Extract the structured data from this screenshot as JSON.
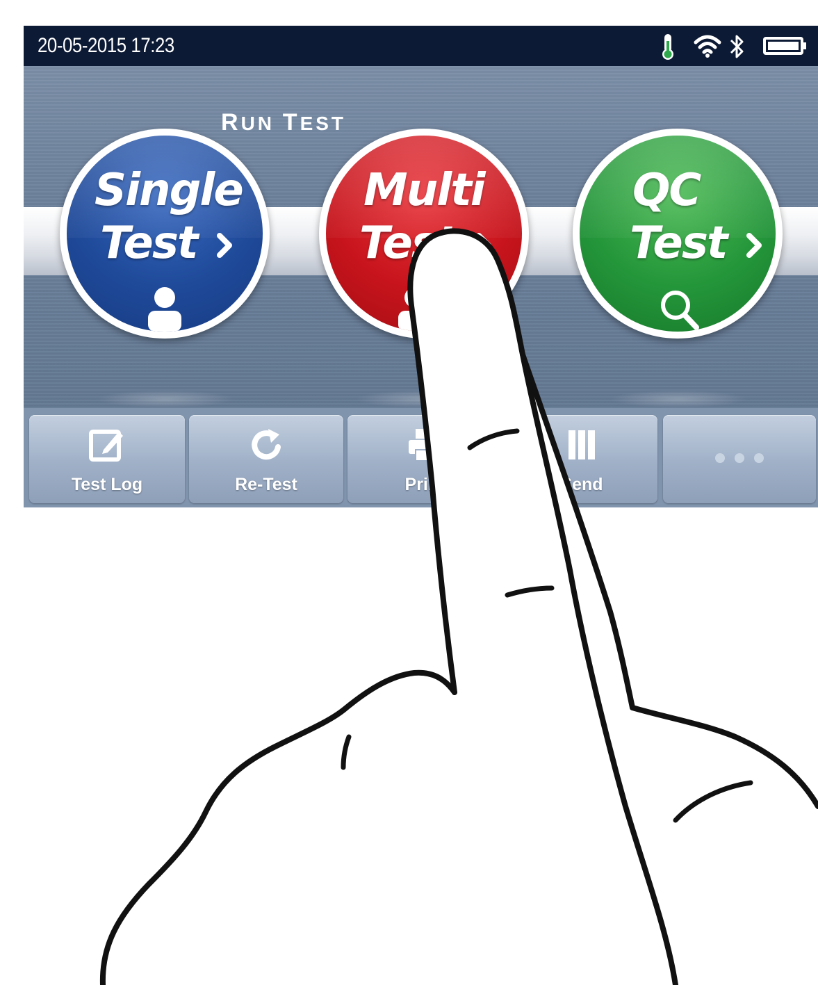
{
  "status_bar": {
    "datetime": "20-05-2015  17:23",
    "icons": [
      "thermometer-icon",
      "wifi-icon",
      "bluetooth-icon",
      "battery-icon"
    ],
    "background": "#0d1a35"
  },
  "run_test": {
    "title_cap1": "R",
    "title_rest1": "UN ",
    "title_cap2": "T",
    "title_rest2": "EST",
    "buttons": [
      {
        "line1": "Single",
        "line2": "Test",
        "color": "#1f4a9a",
        "icon": "user-icon"
      },
      {
        "line1": "Multi",
        "line2": "Test",
        "color": "#c8141c",
        "icon": "user-icon"
      },
      {
        "line1": "QC",
        "line2": "Test",
        "color": "#24963a",
        "icon": "search-icon"
      }
    ]
  },
  "toolbar": {
    "items": [
      {
        "label": "Test Log",
        "icon": "edit-icon"
      },
      {
        "label": "Re-Test",
        "icon": "refresh-icon"
      },
      {
        "label": "Print",
        "icon": "print-icon"
      },
      {
        "label": "Send",
        "icon": "send-icon"
      },
      {
        "label": "",
        "icon": "more-icon"
      }
    ]
  }
}
